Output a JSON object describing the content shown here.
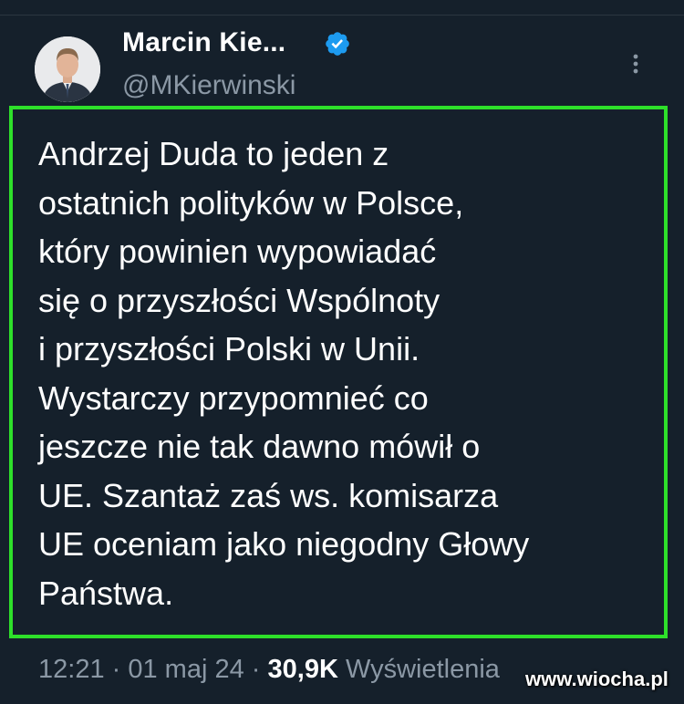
{
  "author": {
    "name": "Marcin Kie...",
    "handle": "@MKierwinski"
  },
  "icons": {
    "verified": "verified-badge-icon",
    "more": "more-vertical-icon"
  },
  "colors": {
    "background": "#15202b",
    "highlight_border": "#2ee02a",
    "verified_blue": "#1d9bf0",
    "muted_text": "#8b98a5"
  },
  "tweet": {
    "text": "Andrzej Duda to jeden z\nostatnich polityków w Polsce,\nktóry powinien wypowiadać\nsię o przyszłości Wspólnoty\ni przyszłości Polski w Unii.\nWystarczy przypomnieć co\njeszcze nie tak dawno mówił o\nUE. Szantaż zaś ws. komisarza\nUE oceniam jako niegodny Głowy\nPaństwa."
  },
  "meta": {
    "time": "12:21",
    "separator": " · ",
    "date": "01 maj 24",
    "views_count": "30,9K",
    "views_label": "Wyświetlenia"
  },
  "watermark": {
    "text": "www.wiocha.pl"
  }
}
